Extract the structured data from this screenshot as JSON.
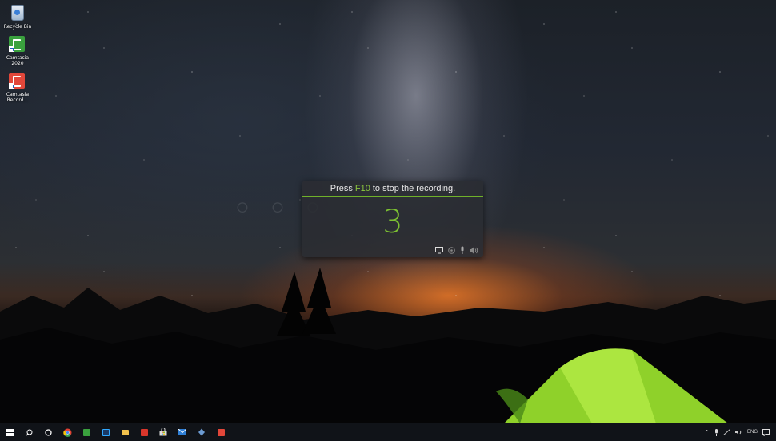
{
  "desktop": {
    "icons": [
      {
        "label": "Recycle Bin",
        "icon": "recycle-bin-icon"
      },
      {
        "label": "Camtasia 2020",
        "icon": "camtasia-icon"
      },
      {
        "label": "Camtasia Record...",
        "icon": "camtasia-recorder-icon"
      }
    ]
  },
  "recorder": {
    "hint_prefix": "Press",
    "hint_key": "F10",
    "hint_suffix": "to stop the recording.",
    "countdown": "3",
    "accent_color": "#7cc032",
    "tool_icons": [
      "screen-icon",
      "camera-icon",
      "microphone-icon",
      "speaker-icon"
    ]
  },
  "taskbar": {
    "apps": [
      "start-icon",
      "search-icon",
      "cortana-icon",
      "chrome-icon",
      "camtasia-icon",
      "photoshop-icon",
      "file-explorer-icon",
      "acrobat-icon",
      "store-icon",
      "mail-icon",
      "app-icon",
      "camtasia-recorder-icon"
    ],
    "tray": {
      "language": "ENG"
    }
  },
  "colors": {
    "taskbar_bg": "#101318",
    "camtasia_green": "#3aa13e",
    "camtasia_red": "#e2473a"
  }
}
